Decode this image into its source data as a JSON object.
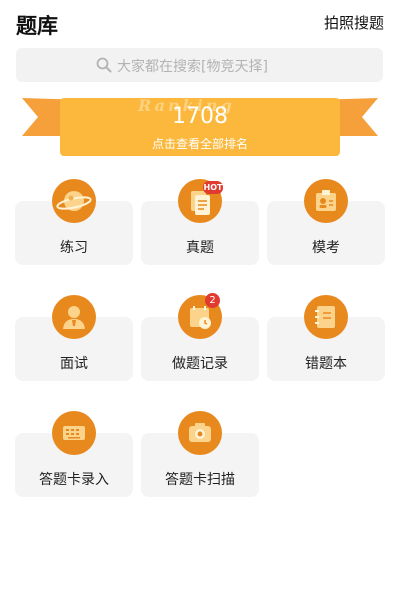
{
  "header": {
    "title": "题库",
    "scan_link": "拍照搜题"
  },
  "search": {
    "placeholder": "大家都在搜索[物竞天择]",
    "icon": "search-icon"
  },
  "banner": {
    "count": "1708",
    "rank_text": "点击查看全部排名",
    "watermark": "Ranking"
  },
  "tiles": [
    {
      "label": "练习",
      "icon": "planet-icon"
    },
    {
      "label": "真题",
      "icon": "documents-icon",
      "tag": "HOT"
    },
    {
      "label": "模考",
      "icon": "id-card-icon"
    },
    {
      "label": "面试",
      "icon": "person-icon"
    },
    {
      "label": "做题记录",
      "icon": "calendar-clock-icon",
      "badge": "2"
    },
    {
      "label": "错题本",
      "icon": "notebook-icon"
    },
    {
      "label": "答题卡录入",
      "icon": "keyboard-icon"
    },
    {
      "label": "答题卡扫描",
      "icon": "camera-icon"
    }
  ],
  "colors": {
    "accent": "#e8891e",
    "banner": "#fbb83c",
    "ribbon": "#f5a03a",
    "badge": "#e13a2e",
    "tile_bg": "#f4f4f4"
  }
}
